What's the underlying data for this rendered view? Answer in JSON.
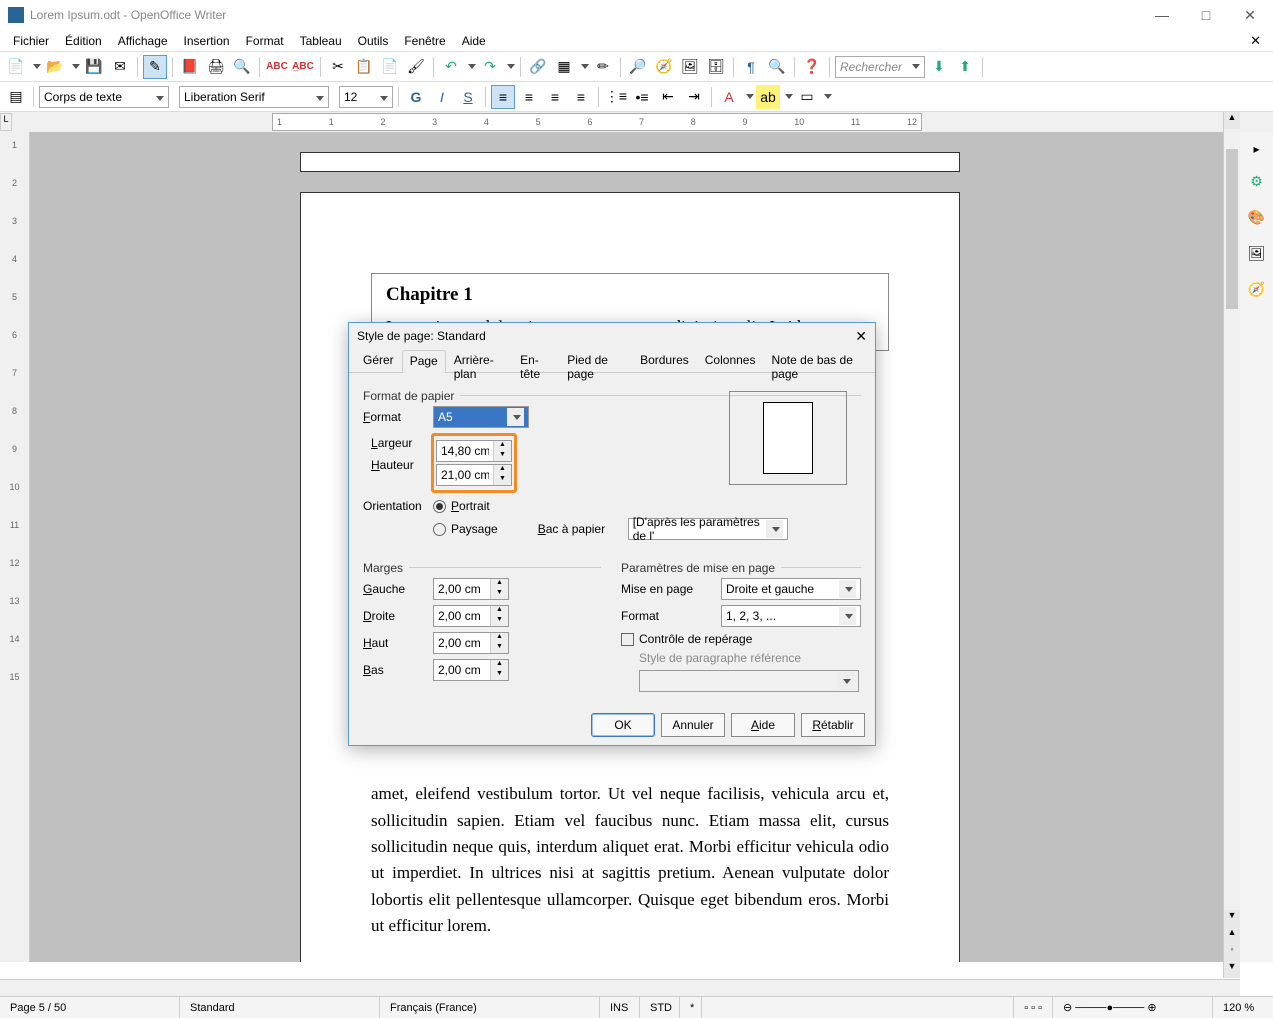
{
  "window": {
    "title": "Lorem Ipsum.odt - OpenOffice Writer"
  },
  "menu": {
    "items": [
      "Fichier",
      "Édition",
      "Affichage",
      "Insertion",
      "Format",
      "Tableau",
      "Outils",
      "Fenêtre",
      "Aide"
    ]
  },
  "toolbar": {
    "search_placeholder": "Rechercher"
  },
  "format": {
    "style": "Corps de texte",
    "font": "Liberation Serif",
    "size": "12"
  },
  "document": {
    "heading": "Chapitre 1",
    "para1": "Lorem ipsum dolor sit amet, consectetur adipiscing elit. In id",
    "para2": "amet, eleifend vestibulum tortor. Ut vel neque facilisis, vehicula arcu et, sollicitudin sapien. Etiam vel faucibus nunc. Etiam massa elit, cursus sollicitudin neque quis, interdum aliquet erat. Morbi efficitur vehicula odio ut imperdiet. In ultrices nisi at sagittis pretium. Aenean vulputate dolor lobortis elit pellentesque ullamcorper. Quisque eget bibendum eros. Morbi ut efficitur lorem."
  },
  "dialog": {
    "title": "Style de page: Standard",
    "tabs": [
      "Gérer",
      "Page",
      "Arrière-plan",
      "En-tête",
      "Pied de page",
      "Bordures",
      "Colonnes",
      "Note de bas de page"
    ],
    "group_paper": "Format de papier",
    "format_label": "Format",
    "format_value": "A5",
    "width_label": "Largeur",
    "width_value": "14,80 cm",
    "height_label": "Hauteur",
    "height_value": "21,00 cm",
    "orientation_label": "Orientation",
    "portrait_label": "Portrait",
    "paysage_label": "Paysage",
    "tray_label": "Bac à papier",
    "tray_value": "[D'après les paramètres de l'",
    "group_margins": "Marges",
    "margin_left": "Gauche",
    "margin_left_v": "2,00 cm",
    "margin_right": "Droite",
    "margin_right_v": "2,00 cm",
    "margin_top": "Haut",
    "margin_top_v": "2,00 cm",
    "margin_bottom": "Bas",
    "margin_bottom_v": "2,00 cm",
    "group_layout": "Paramètres de mise en page",
    "layout_label": "Mise en page",
    "layout_value": "Droite et gauche",
    "numfmt_label": "Format",
    "numfmt_value": "1, 2, 3, ...",
    "register_label": "Contrôle de repérage",
    "refstyle_label": "Style de paragraphe référence",
    "btn_ok": "OK",
    "btn_cancel": "Annuler",
    "btn_help": "Aide",
    "btn_reset": "Rétablir"
  },
  "status": {
    "page": "Page 5 / 50",
    "style": "Standard",
    "lang": "Français (France)",
    "ins": "INS",
    "std": "STD",
    "mod": "*",
    "zoom": "120 %"
  },
  "ruler": [
    "1",
    "1",
    "2",
    "3",
    "4",
    "5",
    "6",
    "7",
    "8",
    "9",
    "10",
    "11",
    "12"
  ]
}
